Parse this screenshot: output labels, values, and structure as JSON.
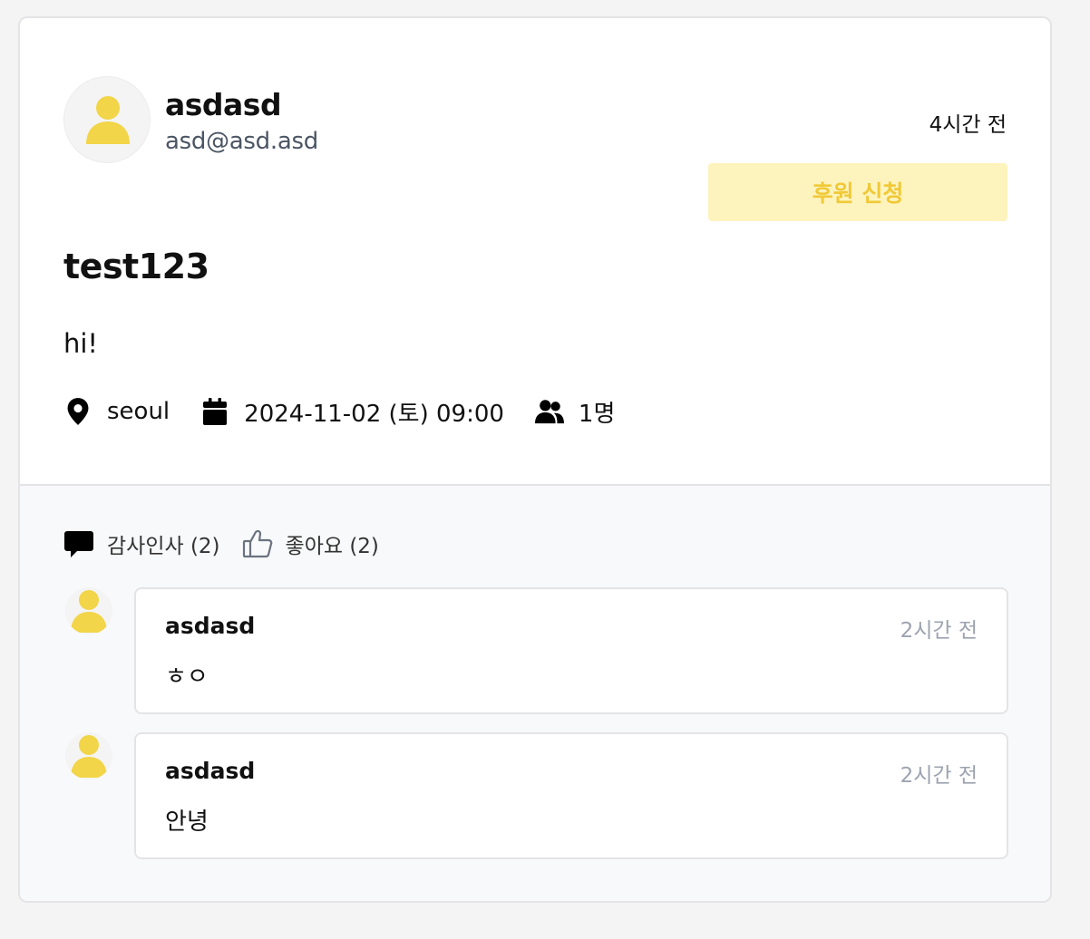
{
  "post": {
    "author_name": "asdasd",
    "author_email": "asd@asd.asd",
    "time_ago": "4시간 전",
    "sponsor_button": "후원 신청",
    "title": "test123",
    "body": "hi!",
    "location": "seoul",
    "datetime": "2024-11-02 (토) 09:00",
    "participants": "1명"
  },
  "reactions": {
    "thanks_label": "감사인사 (2)",
    "likes_label": "좋아요 (2)"
  },
  "comments": [
    {
      "author": "asdasd",
      "time_ago": "2시간 전",
      "text": "ㅎㅇ"
    },
    {
      "author": "asdasd",
      "time_ago": "2시간 전",
      "text": "안녕"
    }
  ],
  "icons": {
    "avatar": "user-avatar-icon",
    "location": "map-pin-icon",
    "date": "calendar-icon",
    "participants": "users-icon",
    "thanks": "speech-bubble-icon",
    "likes": "thumbs-up-icon"
  },
  "colors": {
    "accent_yellow": "#f2d548",
    "button_bg": "#fdf3bd",
    "button_text": "#f0c936",
    "muted_text": "#9ca3af",
    "bottom_bg": "#f8f9fa"
  }
}
